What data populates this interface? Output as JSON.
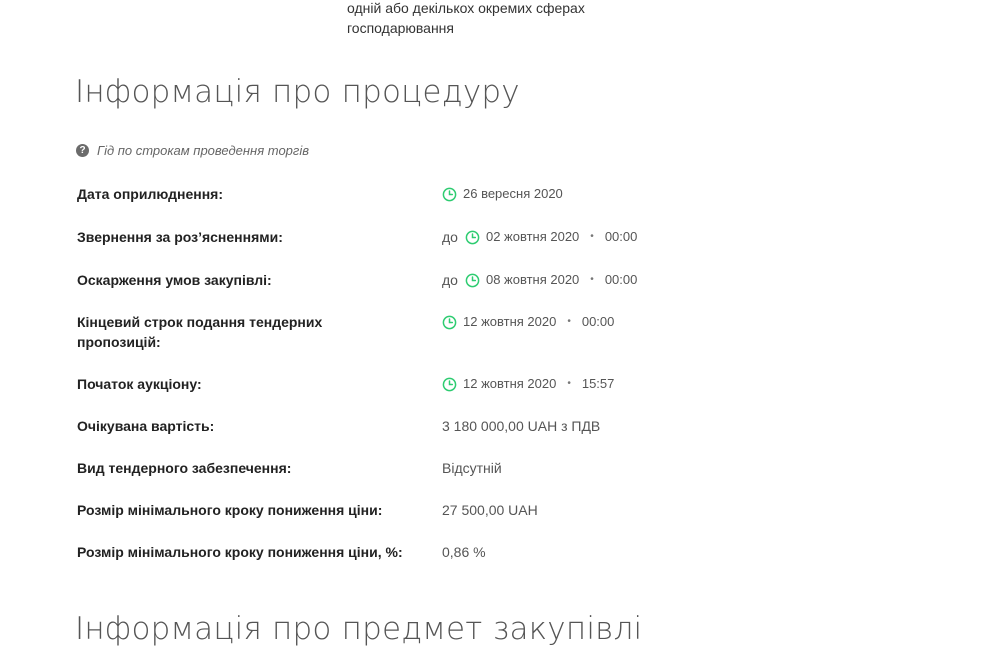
{
  "top": {
    "left_fragment": "",
    "lines": [
      "одній або декількох окремих сферах",
      "господарювання"
    ]
  },
  "procedure": {
    "title": "Інформація про процедуру",
    "guide_label": "Гід по строкам проведення торгів",
    "rows": [
      {
        "label": "Дата оприлюднення:",
        "prefix": "",
        "date": "26 вересня 2020",
        "time": ""
      },
      {
        "label": "Звернення за роз’ясненнями:",
        "prefix": "до",
        "date": "02 жовтня 2020",
        "time": "00:00"
      },
      {
        "label": "Оскарження умов закупівлі:",
        "prefix": "до",
        "date": "08 жовтня 2020",
        "time": "00:00"
      },
      {
        "label": "Кінцевий строк подання тендерних пропозицій:",
        "prefix": "",
        "date": "12 жовтня 2020",
        "time": "00:00"
      },
      {
        "label": "Початок аукціону:",
        "prefix": "",
        "date": "12 жовтня 2020",
        "time": "15:57"
      },
      {
        "label": "Очікувана вартість:",
        "value": "3 180 000,00 UAH з ПДВ"
      },
      {
        "label": "Вид тендерного забезпечення:",
        "value": "Відсутній"
      },
      {
        "label": "Розмір мінімального кроку пониження ціни:",
        "value": "27 500,00 UAH"
      },
      {
        "label": "Розмір мінімального кроку пониження ціни, %:",
        "value": "0,86 %"
      }
    ]
  },
  "subject": {
    "title": "Інформація про предмет закупівлі"
  },
  "colors": {
    "clock": "#2ecc71",
    "heading": "#555555",
    "label": "#222222"
  },
  "icons": {
    "guide": "question-circle-icon",
    "date": "clock-icon"
  }
}
